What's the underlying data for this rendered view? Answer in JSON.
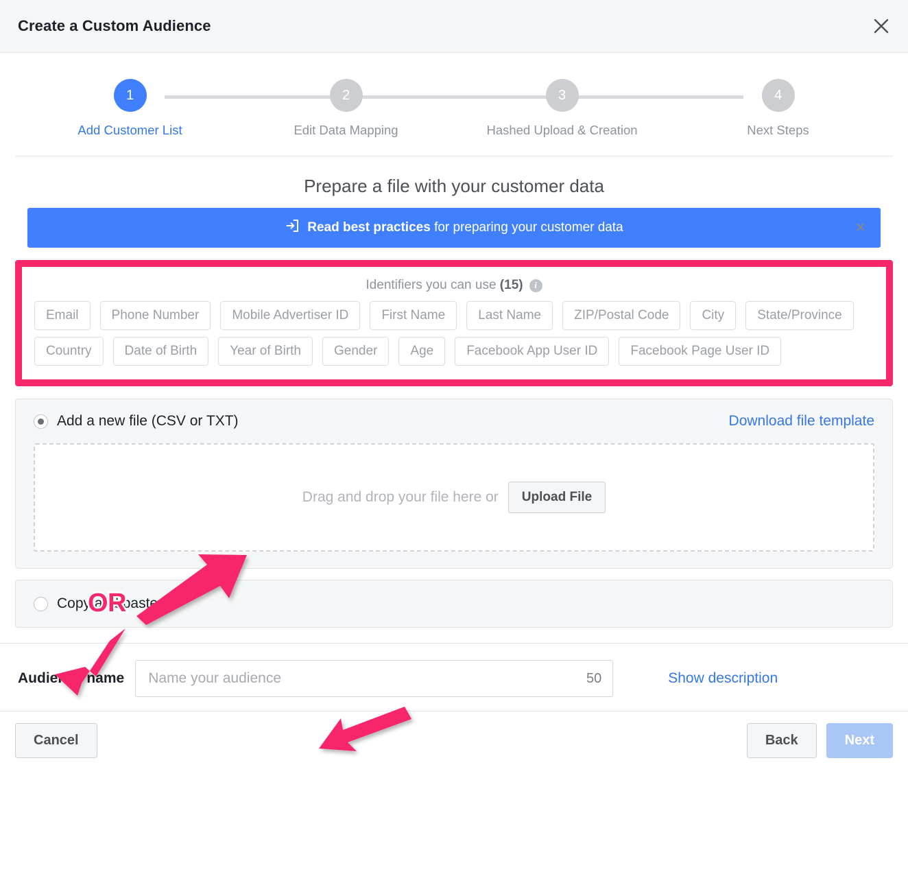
{
  "dialog": {
    "title": "Create a Custom Audience",
    "close_icon": "close-icon"
  },
  "stepper": {
    "steps": [
      {
        "number": "1",
        "label": "Add Customer List",
        "state": "active"
      },
      {
        "number": "2",
        "label": "Edit Data Mapping",
        "state": "inactive"
      },
      {
        "number": "3",
        "label": "Hashed Upload & Creation",
        "state": "inactive"
      },
      {
        "number": "4",
        "label": "Next Steps",
        "state": "inactive"
      }
    ]
  },
  "main": {
    "section_title": "Prepare a file with your customer data",
    "banner": {
      "icon": "open-in-box-icon",
      "strong_text": "Read best practices",
      "rest_text": " for preparing your customer data",
      "close_label": "×",
      "color": "#4080ff"
    },
    "identifiers": {
      "heading_text": "Identifiers you can use ",
      "count": "(15)",
      "info_icon": "info-icon",
      "chips": [
        "Email",
        "Phone Number",
        "Mobile Advertiser ID",
        "First Name",
        "Last Name",
        "ZIP/Postal Code",
        "City",
        "State/Province",
        "Country",
        "Date of Birth",
        "Year of Birth",
        "Gender",
        "Age",
        "Facebook App User ID",
        "Facebook Page User ID"
      ],
      "highlight_color": "#f7286a"
    },
    "file_panel": {
      "radio_label": "Add a new file (CSV or TXT)",
      "radio_selected": true,
      "download_link": "Download file template",
      "dropzone_text": "Drag and drop your file here or",
      "upload_button": "Upload File"
    },
    "paste_panel": {
      "radio_label": "Copy and paste",
      "radio_selected": false
    }
  },
  "audience": {
    "label": "Audience name",
    "placeholder": "Name your audience",
    "value": "",
    "char_count": "50",
    "show_description": "Show description"
  },
  "footer": {
    "cancel": "Cancel",
    "back": "Back",
    "next": "Next"
  },
  "annotations": {
    "or_label": "OR",
    "arrow_color": "#f7286a"
  }
}
